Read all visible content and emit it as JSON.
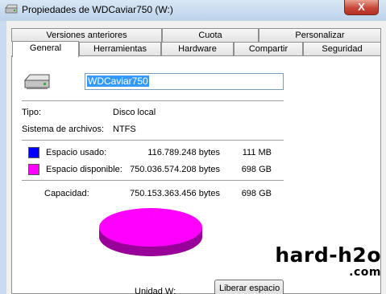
{
  "window": {
    "title": "Propiedades de WDCaviar750 (W:)",
    "close_glyph": "X"
  },
  "tabs_back": [
    "Versiones anteriores",
    "Cuota",
    "Personalizar"
  ],
  "tabs_front": [
    "General",
    "Herramientas",
    "Hardware",
    "Compartir",
    "Seguridad"
  ],
  "active_tab": "General",
  "general": {
    "volume_name": "WDCaviar750",
    "type_label": "Tipo:",
    "type_value": "Disco local",
    "fs_label": "Sistema de archivos:",
    "fs_value": "NTFS",
    "used_label": "Espacio usado:",
    "used_bytes": "116.789.248 bytes",
    "used_size": "111 MB",
    "used_color": "#0000ff",
    "free_label": "Espacio disponible:",
    "free_bytes": "750.036.574.208 bytes",
    "free_size": "698 GB",
    "free_color": "#ff00ff",
    "capacity_label": "Capacidad:",
    "capacity_bytes": "750.153.363.456 bytes",
    "capacity_size": "698 GB",
    "drive_label": "Unidad W:",
    "cleanup_button": "Liberar espacio"
  },
  "pie": {
    "used_fraction": 0.0001557
  },
  "watermark": {
    "brand": "hard-h2o",
    "domain": ".com"
  },
  "icons": {
    "title": "drive-icon",
    "drive": "hard-drive-icon"
  }
}
